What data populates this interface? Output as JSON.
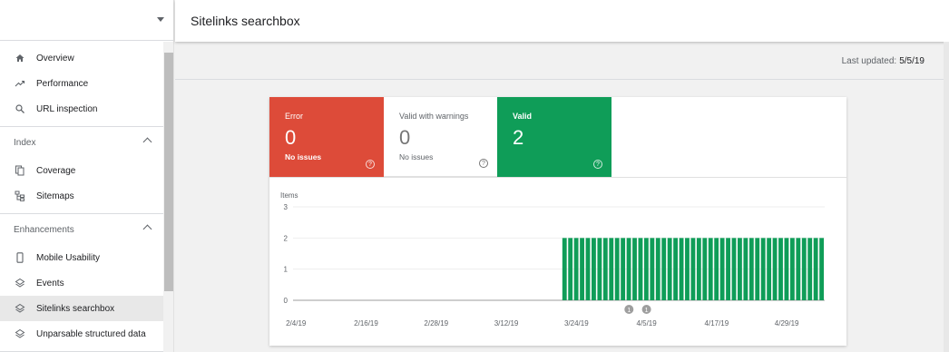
{
  "header": {
    "title": "Sitelinks searchbox"
  },
  "last_updated": {
    "label": "Last updated:",
    "value": "5/5/19"
  },
  "sidebar": {
    "top_items": [
      {
        "label": "Overview",
        "icon": "home-icon"
      },
      {
        "label": "Performance",
        "icon": "trending-icon"
      },
      {
        "label": "URL inspection",
        "icon": "search-icon"
      }
    ],
    "index": {
      "title": "Index",
      "items": [
        {
          "label": "Coverage",
          "icon": "coverage-icon"
        },
        {
          "label": "Sitemaps",
          "icon": "sitemap-icon"
        }
      ]
    },
    "enhancements": {
      "title": "Enhancements",
      "items": [
        {
          "label": "Mobile Usability",
          "icon": "phone-icon"
        },
        {
          "label": "Events",
          "icon": "layers-icon"
        },
        {
          "label": "Sitelinks searchbox",
          "icon": "layers-icon",
          "active": true
        },
        {
          "label": "Unparsable structured data",
          "icon": "layers-icon"
        }
      ]
    }
  },
  "tiles": {
    "error": {
      "label": "Error",
      "count": "0",
      "sub": "No issues",
      "color": "#dd4b39"
    },
    "warning": {
      "label": "Valid with warnings",
      "count": "0",
      "sub": "No issues"
    },
    "valid": {
      "label": "Valid",
      "count": "2",
      "color": "#0f9d58"
    }
  },
  "chart_data": {
    "type": "bar",
    "ylabel": "Items",
    "ylim": [
      0,
      3
    ],
    "yticks": [
      "0",
      "1",
      "2",
      "3"
    ],
    "x_tick_labels": [
      "2/4/19",
      "2/16/19",
      "2/28/19",
      "3/12/19",
      "3/24/19",
      "4/5/19",
      "4/17/19",
      "4/29/19"
    ],
    "x_start": "2/4/19",
    "x_end": "5/5/19",
    "bar_color": "#0f9d58",
    "series": [
      {
        "values_from": "3/22/19",
        "values_to": "5/5/19",
        "value": 2
      }
    ],
    "annotations": [
      {
        "date": "4/2/19",
        "label": "1"
      },
      {
        "date": "4/5/19",
        "label": "1"
      }
    ]
  }
}
